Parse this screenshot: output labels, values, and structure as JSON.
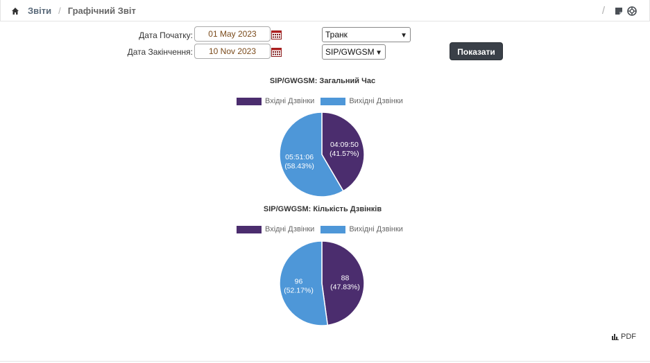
{
  "breadcrumb": {
    "root": "Звіти",
    "separator": "/",
    "current": "Графічний Звіт"
  },
  "toolbar": {
    "separator": "/"
  },
  "form": {
    "start_label": "Дата Початку:",
    "start_value": "01 May 2023",
    "end_label": "Дата Закінчення:",
    "end_value": "10 Nov 2023",
    "type_select": "Транк",
    "trunk_select": "SIP/GWGSM",
    "submit": "Показати"
  },
  "colors": {
    "incoming": "#4b2d6e",
    "outgoing": "#4e97d8"
  },
  "chart_data": [
    {
      "type": "pie",
      "title": "SIP/GWGSM: Загальний Час",
      "legend": [
        "Вхідні Дзвінки",
        "Вихідні Дзвінки"
      ],
      "slices": [
        {
          "name": "Вхідні Дзвінки",
          "label": "04:09:50",
          "percent_label": "(41.57%)",
          "value": 41.57
        },
        {
          "name": "Вихідні Дзвінки",
          "label": "05:51:06",
          "percent_label": "(58.43%)",
          "value": 58.43
        }
      ]
    },
    {
      "type": "pie",
      "title": "SIP/GWGSM: Кількість Дзвінків",
      "legend": [
        "Вхідні Дзвінки",
        "Вихідні Дзвінки"
      ],
      "slices": [
        {
          "name": "Вхідні Дзвінки",
          "label": "88",
          "percent_label": "(47.83%)",
          "value": 47.83
        },
        {
          "name": "Вихідні Дзвінки",
          "label": "96",
          "percent_label": "(52.17%)",
          "value": 52.17
        }
      ]
    }
  ],
  "export": {
    "pdf": "PDF"
  }
}
